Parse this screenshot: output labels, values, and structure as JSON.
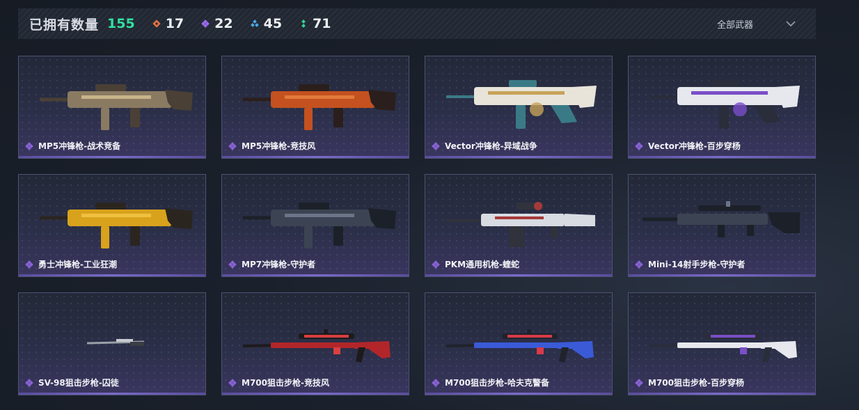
{
  "header": {
    "owned_label": "已拥有数量",
    "owned_count": "155",
    "stats": [
      {
        "icon": "orange-diamond-icon",
        "value": "17",
        "color": "#e0744a"
      },
      {
        "icon": "purple-diamond-icon",
        "value": "22",
        "color": "#9a6cf0"
      },
      {
        "icon": "blue-diamond-icon",
        "value": "45",
        "color": "#4aa8e8"
      },
      {
        "icon": "green-dots-icon",
        "value": "71",
        "color": "#34d39a"
      }
    ],
    "filter": {
      "label": "全部武器",
      "icon": "chevron-down-icon"
    }
  },
  "colors": {
    "accent_green": "#32e0a0",
    "card_border": "#4d5373",
    "quality_purple": "#8a63d6"
  },
  "weapons": [
    {
      "name": "MP5冲锋枪-战术竞备",
      "quality": "purple",
      "palette": "tan",
      "kind": "smg"
    },
    {
      "name": "MP5冲锋枪-竞技风",
      "quality": "purple",
      "palette": "orange",
      "kind": "smg"
    },
    {
      "name": "Vector冲锋枪-异域战争",
      "quality": "purple",
      "palette": "ornate",
      "kind": "vector"
    },
    {
      "name": "Vector冲锋枪-百步穿杨",
      "quality": "purple",
      "palette": "white",
      "kind": "vector"
    },
    {
      "name": "勇士冲锋枪-工业狂潮",
      "quality": "purple",
      "palette": "yellow",
      "kind": "smg"
    },
    {
      "name": "MP7冲锋枪-守护者",
      "quality": "purple",
      "palette": "dark",
      "kind": "smg"
    },
    {
      "name": "PKM通用机枪-蝰蛇",
      "quality": "purple",
      "palette": "snow",
      "kind": "mg"
    },
    {
      "name": "Mini-14射手步枪-守护者",
      "quality": "purple",
      "palette": "dark",
      "kind": "rifle"
    },
    {
      "name": "SV-98狙击步枪-囚徒",
      "quality": "purple",
      "palette": "grey",
      "kind": "tiny"
    },
    {
      "name": "M700狙击步枪-竞技风",
      "quality": "purple",
      "palette": "red",
      "kind": "sniper"
    },
    {
      "name": "M700狙击步枪-哈夫克警备",
      "quality": "purple",
      "palette": "flag",
      "kind": "sniper"
    },
    {
      "name": "M700狙击步枪-百步穿杨",
      "quality": "purple",
      "palette": "white",
      "kind": "sniper"
    }
  ]
}
